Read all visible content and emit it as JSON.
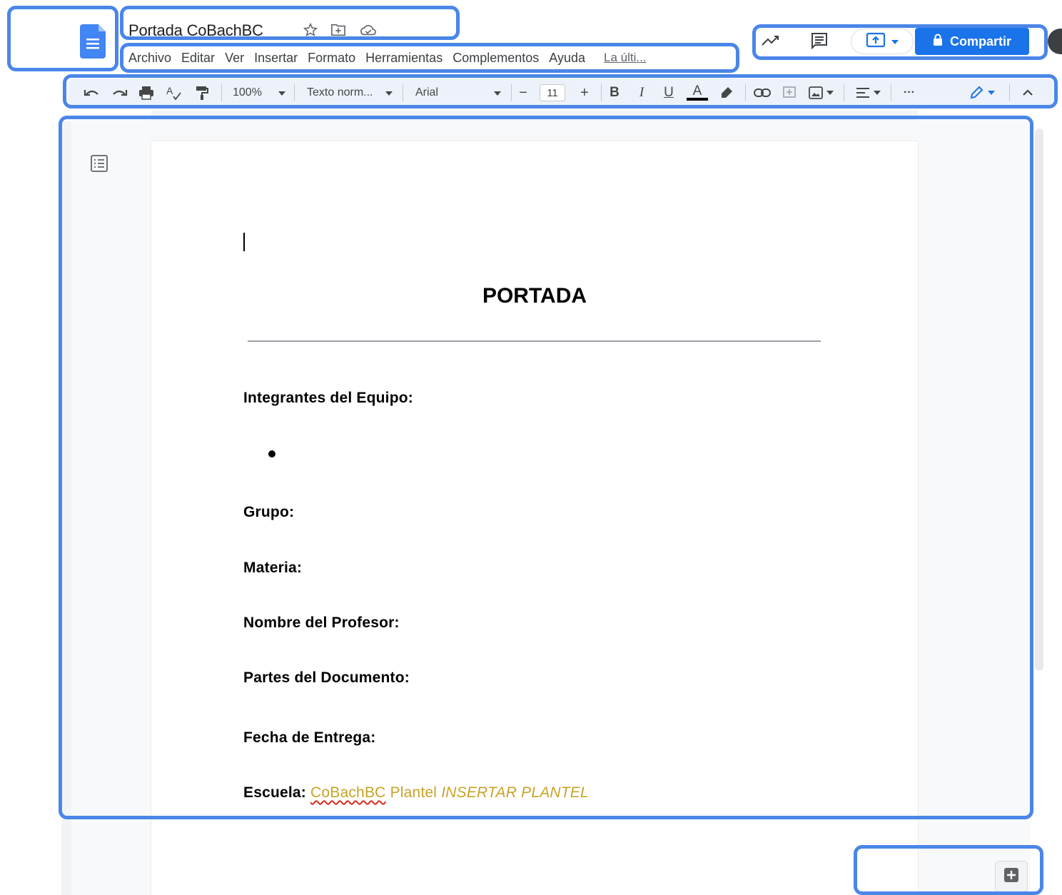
{
  "document": {
    "title": "Portada CoBachBC"
  },
  "menu": {
    "items": [
      "Archivo",
      "Editar",
      "Ver",
      "Insertar",
      "Formato",
      "Herramientas",
      "Complementos",
      "Ayuda"
    ],
    "last_edit": "La últi..."
  },
  "header_right": {
    "share_label": "Compartir"
  },
  "toolbar": {
    "zoom": "100%",
    "style": "Texto norm...",
    "font": "Arial",
    "font_size": "11",
    "bold": "B",
    "italic": "I",
    "underline": "U",
    "text_color": "A",
    "more": "···",
    "decrease": "−",
    "increase": "+"
  },
  "page": {
    "heading": "PORTADA",
    "fields": {
      "integrantes": "Integrantes del Equipo:",
      "grupo": "Grupo:",
      "materia": "Materia:",
      "profesor": "Nombre del Profesor:",
      "partes": "Partes del Documento:",
      "fecha": "Fecha de Entrega:",
      "escuela": "Escuela:"
    },
    "escuela_value": {
      "school": "CoBachBC",
      "plantel": "Plantel",
      "placeholder": "INSERTAR PLANTEL"
    }
  },
  "colors": {
    "highlight": "#4a86e8",
    "brand_blue": "#1a73e8",
    "gold_text": "#c9a227"
  },
  "icons": [
    "docs-logo-icon",
    "star-icon",
    "move-folder-icon",
    "cloud-status-icon",
    "activity-icon",
    "comments-icon",
    "present-icon",
    "lock-icon",
    "undo-icon",
    "redo-icon",
    "print-icon",
    "spellcheck-icon",
    "paint-format-icon",
    "highlight-icon",
    "link-icon",
    "add-comment-icon",
    "image-icon",
    "align-icon",
    "edit-mode-icon",
    "collapse-icon",
    "outline-icon",
    "explore-icon"
  ]
}
